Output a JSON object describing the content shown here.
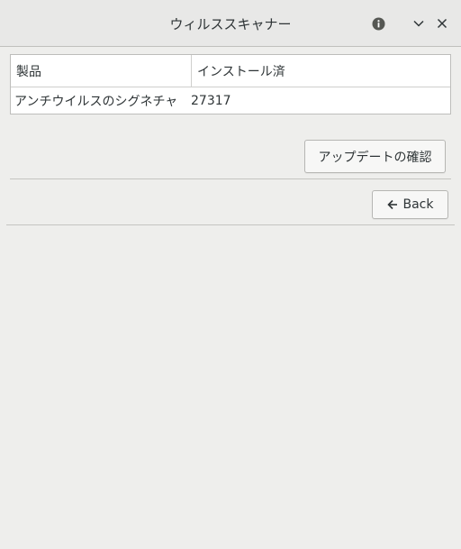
{
  "window": {
    "title": "ウィルススキャナー"
  },
  "titlebar_icons": {
    "info": "info-icon",
    "collapse": "chevron-down-icon",
    "close": "close-icon"
  },
  "table": {
    "headers": [
      "製品",
      "インストール済"
    ],
    "rows": [
      {
        "product": "アンチウイルスのシグネチャ",
        "installed": "27317"
      }
    ]
  },
  "actions": {
    "check_updates_label": "アップデートの確認",
    "back_label": "Back",
    "back_icon": "arrow-left-icon"
  },
  "colors": {
    "background": "#eeeeec",
    "titlebar": "#e8e8e7",
    "text": "#2e3436"
  }
}
